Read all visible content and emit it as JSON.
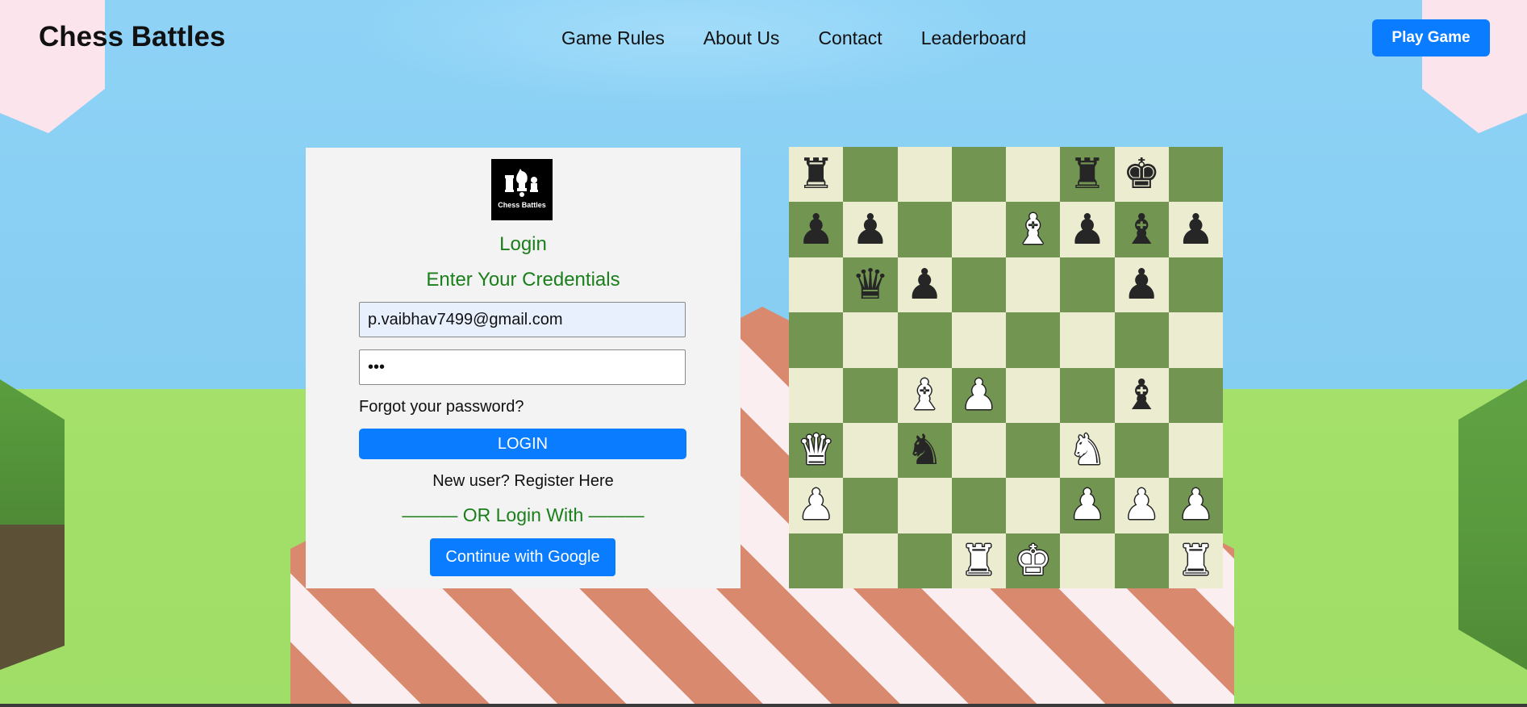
{
  "header": {
    "brand": "Chess Battles",
    "nav": [
      "Game Rules",
      "About Us",
      "Contact",
      "Leaderboard"
    ],
    "play_button": "Play Game"
  },
  "login": {
    "logo_text": "Chess Battles",
    "title": "Login",
    "subtitle": "Enter Your Credentials",
    "email_value": "p.vaibhav7499@gmail.com",
    "password_value": "•••",
    "forgot_link": "Forgot your password?",
    "login_button": "LOGIN",
    "register_link": "New user? Register Here",
    "or_divider": "——— OR Login With ———",
    "google_button": "Continue with Google"
  },
  "board": {
    "light_color": "#ebecd0",
    "dark_color": "#739552",
    "rows": [
      [
        "br",
        "",
        "",
        "",
        "",
        "br",
        "bk",
        ""
      ],
      [
        "bp",
        "bp",
        "",
        "",
        "wb",
        "bp",
        "bb",
        "bp"
      ],
      [
        "",
        "bq",
        "bp",
        "",
        "",
        "",
        "bp",
        ""
      ],
      [
        "",
        "",
        "",
        "",
        "",
        "",
        "",
        ""
      ],
      [
        "",
        "",
        "wb",
        "wp",
        "",
        "",
        "bb",
        ""
      ],
      [
        "wq",
        "",
        "bn",
        "",
        "",
        "wn",
        "",
        ""
      ],
      [
        "wp",
        "",
        "",
        "",
        "",
        "wp",
        "wp",
        "wp"
      ],
      [
        "",
        "",
        "",
        "wr",
        "wk",
        "",
        "",
        "wr"
      ]
    ]
  },
  "colors": {
    "accent_blue": "#0a7cff",
    "heading_green": "#1a7f1a"
  }
}
